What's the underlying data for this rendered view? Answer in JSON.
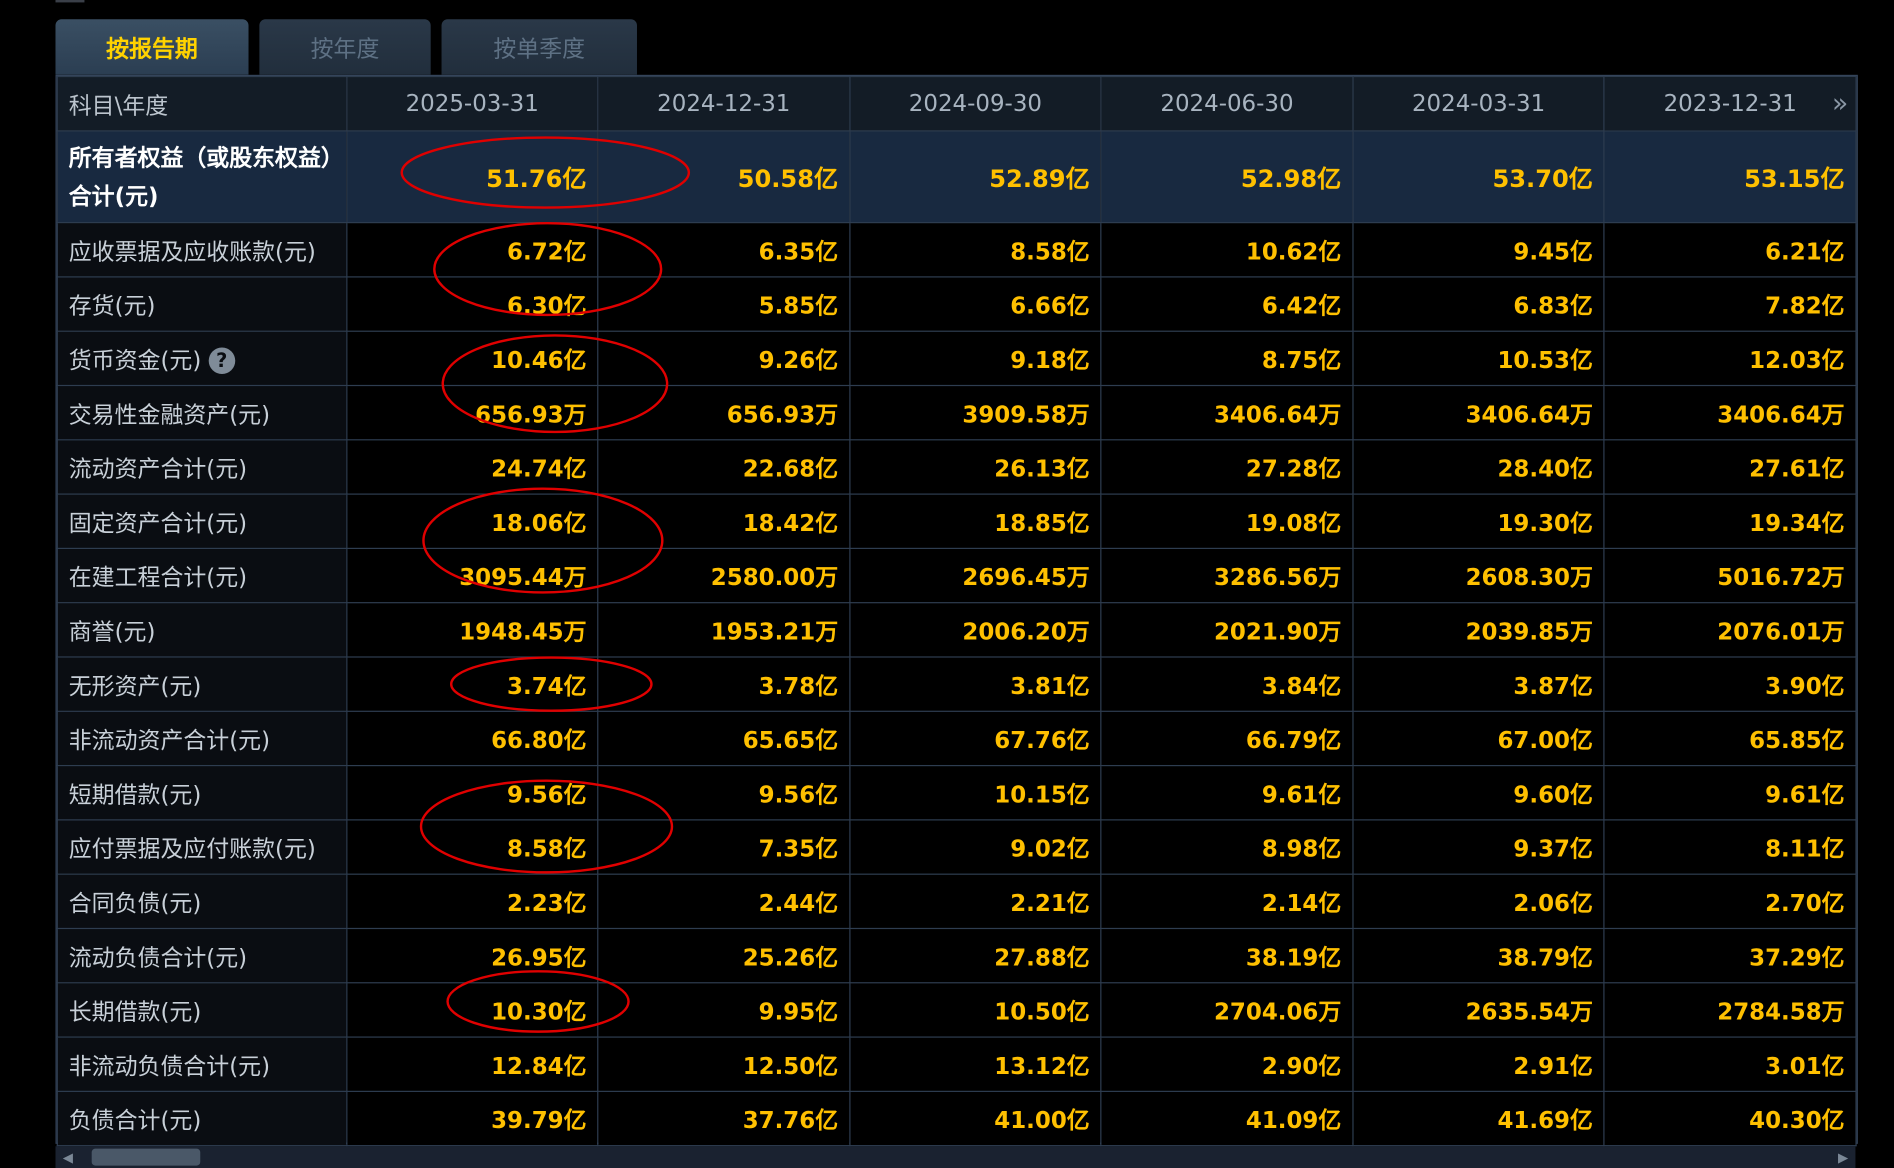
{
  "tabs": [
    "按报告期",
    "按年度",
    "按单季度"
  ],
  "active_tab": 0,
  "header": {
    "label": "科目\\年度",
    "periods": [
      "2025-03-31",
      "2024-12-31",
      "2024-09-30",
      "2024-06-30",
      "2024-03-31",
      "2023-12-31"
    ]
  },
  "rows": [
    {
      "label": "所有者权益（或股东权益）合计(元)",
      "values": [
        "51.76亿",
        "50.58亿",
        "52.89亿",
        "52.98亿",
        "53.70亿",
        "53.15亿"
      ],
      "highlight": true
    },
    {
      "label": "应收票据及应收账款(元)",
      "values": [
        "6.72亿",
        "6.35亿",
        "8.58亿",
        "10.62亿",
        "9.45亿",
        "6.21亿"
      ]
    },
    {
      "label": "存货(元)",
      "values": [
        "6.30亿",
        "5.85亿",
        "6.66亿",
        "6.42亿",
        "6.83亿",
        "7.82亿"
      ]
    },
    {
      "label": "货币资金(元)",
      "values": [
        "10.46亿",
        "9.26亿",
        "9.18亿",
        "8.75亿",
        "10.53亿",
        "12.03亿"
      ],
      "help": "?"
    },
    {
      "label": "交易性金融资产(元)",
      "values": [
        "656.93万",
        "656.93万",
        "3909.58万",
        "3406.64万",
        "3406.64万",
        "3406.64万"
      ]
    },
    {
      "label": "流动资产合计(元)",
      "values": [
        "24.74亿",
        "22.68亿",
        "26.13亿",
        "27.28亿",
        "28.40亿",
        "27.61亿"
      ]
    },
    {
      "label": "固定资产合计(元)",
      "values": [
        "18.06亿",
        "18.42亿",
        "18.85亿",
        "19.08亿",
        "19.30亿",
        "19.34亿"
      ]
    },
    {
      "label": "在建工程合计(元)",
      "values": [
        "3095.44万",
        "2580.00万",
        "2696.45万",
        "3286.56万",
        "2608.30万",
        "5016.72万"
      ]
    },
    {
      "label": "商誉(元)",
      "values": [
        "1948.45万",
        "1953.21万",
        "2006.20万",
        "2021.90万",
        "2039.85万",
        "2076.01万"
      ]
    },
    {
      "label": "无形资产(元)",
      "values": [
        "3.74亿",
        "3.78亿",
        "3.81亿",
        "3.84亿",
        "3.87亿",
        "3.90亿"
      ]
    },
    {
      "label": "非流动资产合计(元)",
      "values": [
        "66.80亿",
        "65.65亿",
        "67.76亿",
        "66.79亿",
        "67.00亿",
        "65.85亿"
      ]
    },
    {
      "label": "短期借款(元)",
      "values": [
        "9.56亿",
        "9.56亿",
        "10.15亿",
        "9.61亿",
        "9.60亿",
        "9.61亿"
      ]
    },
    {
      "label": "应付票据及应付账款(元)",
      "values": [
        "8.58亿",
        "7.35亿",
        "9.02亿",
        "8.98亿",
        "9.37亿",
        "8.11亿"
      ]
    },
    {
      "label": "合同负债(元)",
      "values": [
        "2.23亿",
        "2.44亿",
        "2.21亿",
        "2.14亿",
        "2.06亿",
        "2.70亿"
      ]
    },
    {
      "label": "流动负债合计(元)",
      "values": [
        "26.95亿",
        "25.26亿",
        "27.88亿",
        "38.19亿",
        "38.79亿",
        "37.29亿"
      ]
    },
    {
      "label": "长期借款(元)",
      "values": [
        "10.30亿",
        "9.95亿",
        "10.50亿",
        "2704.06万",
        "2635.54万",
        "2784.58万"
      ]
    },
    {
      "label": "非流动负债合计(元)",
      "values": [
        "12.84亿",
        "12.50亿",
        "13.12亿",
        "2.90亿",
        "2.91亿",
        "3.01亿"
      ]
    },
    {
      "label": "负债合计(元)",
      "values": [
        "39.79亿",
        "37.76亿",
        "41.00亿",
        "41.09亿",
        "41.69亿",
        "40.30亿"
      ]
    }
  ],
  "icons": {
    "more": "double-chevron-right-icon",
    "help": "question-circle-icon"
  },
  "colors": {
    "value": "#ffc000",
    "active_tab": "#ffd200",
    "highlight_row": "#182940",
    "annotation": "#e00000",
    "background": "#000000"
  },
  "annotations": [
    "51.76亿",
    "6.72亿 / 6.30亿",
    "10.46亿 / 656.93万",
    "18.06亿 / 3095.44万",
    "3.74亿",
    "9.56亿 / 8.58亿",
    "10.30亿"
  ]
}
